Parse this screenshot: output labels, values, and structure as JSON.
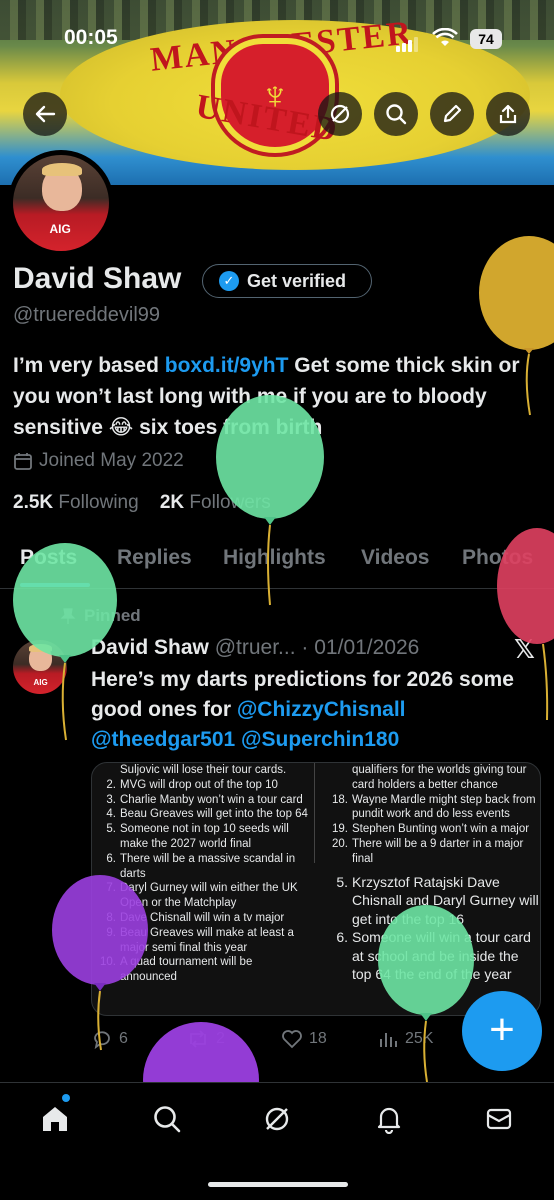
{
  "status": {
    "time": "00:05",
    "battery": "74"
  },
  "banner": {
    "top_word": "MANCHESTER",
    "bottom_word": "UNITED"
  },
  "profile": {
    "name": "David Shaw",
    "verify_label": "Get verified",
    "handle": "@truereddevil99",
    "bio_pre": "I’m very based ",
    "bio_link": "boxd.it/9yhT",
    "bio_mid": " Get some thick skin or you won’t last long with me if you are to bloody sensitive ",
    "bio_emoji": "😂",
    "bio_end": " six toes from birth",
    "joined": "Joined May 2022",
    "following_count": "2.5K",
    "following_label": "Following",
    "followers_count": "2K",
    "followers_label": "Followers"
  },
  "tabs": [
    {
      "label": "Posts"
    },
    {
      "label": "Replies"
    },
    {
      "label": "Highlights"
    },
    {
      "label": "Videos"
    },
    {
      "label": "Photos"
    }
  ],
  "post": {
    "pinned_label": "Pinned",
    "author": "David Shaw",
    "handle_trunc": "@truer...",
    "sep": "·",
    "date": "01/01/2026",
    "text": "Here’s my darts predictions for 2026 some good ones for ",
    "mention1": "@ChizzyChisnall",
    "mention2": "@theedgar501",
    "mention3": "@Superchin180",
    "image_left": [
      {
        "n": "",
        "t": "Suljovic will lose their tour cards."
      },
      {
        "n": "2.",
        "t": "MVG will drop out of the top 10"
      },
      {
        "n": "3.",
        "t": "Charlie Manby won’t win a tour card"
      },
      {
        "n": "4.",
        "t": "Beau Greaves will get into the top 64"
      },
      {
        "n": "5.",
        "t": "Someone not in top 10 seeds will make the 2027 world final"
      },
      {
        "n": "6.",
        "t": "There will be a massive scandal in darts"
      },
      {
        "n": "7.",
        "t": "Daryl Gurney will win either the UK Open or the Matchplay"
      },
      {
        "n": "8.",
        "t": "Dave Chisnall will win a tv major"
      },
      {
        "n": "9.",
        "t": "Beau Greaves will make at least a major semi final this year"
      },
      {
        "n": "10.",
        "t": "A quad tournament will be announced"
      }
    ],
    "image_right": [
      {
        "n": "",
        "t": "qualifiers for the worlds giving tour card holders a better chance"
      },
      {
        "n": "18.",
        "t": "Wayne Mardle might step back from pundit work and do less events"
      },
      {
        "n": "19.",
        "t": "Stephen Bunting won’t win a major"
      },
      {
        "n": "20.",
        "t": "There will be a 9 darter in a major final"
      }
    ],
    "image_right_big": [
      {
        "n": "5.",
        "t": "Krzysztof Ratajski Dave Chisnall and Daryl Gurney will get into the top 16"
      },
      {
        "n": "6.",
        "t": "Someone will win a tour card at school and be inside the top 64 the end of the year"
      }
    ],
    "replies": "6",
    "reposts": "2",
    "likes": "18",
    "views": "25K"
  },
  "colors": {
    "accent": "#1d9bf0",
    "bg": "#000000",
    "muted": "#71767b",
    "text": "#e7e9ea"
  },
  "icons": [
    "back-arrow-icon",
    "grok-icon",
    "search-icon",
    "edit-pencil-icon",
    "share-icon",
    "calendar-icon",
    "pin-icon",
    "x-logo-icon",
    "reply-icon",
    "repost-icon",
    "like-icon",
    "views-icon",
    "home-icon",
    "search-icon",
    "grok-icon",
    "bell-icon",
    "mail-icon",
    "balloon-icon"
  ]
}
